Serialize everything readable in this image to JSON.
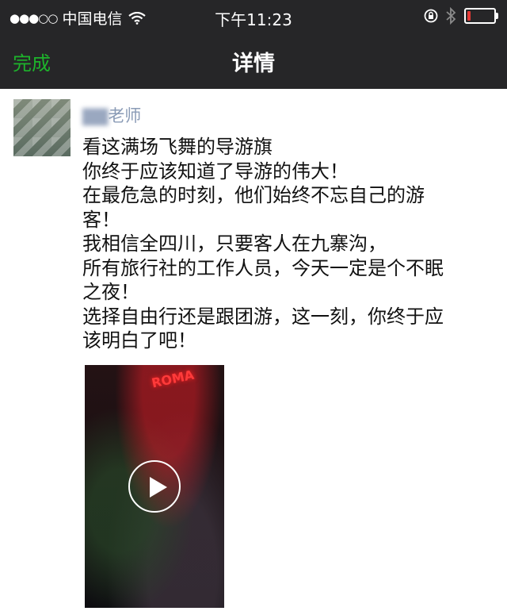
{
  "status_bar": {
    "signal": "●●●○○",
    "carrier": "中国电信",
    "time": "下午11:23",
    "battery_level": 0.12,
    "battery_color": "#e53935"
  },
  "nav_bar": {
    "done_label": "完成",
    "title": "详情",
    "accent_color": "#1db32b"
  },
  "post": {
    "author_masked": "▇▇",
    "author_suffix": "老师",
    "lines": [
      "看这满场飞舞的导游旗",
      "你终于应该知道了导游的伟大！",
      "在最危急的时刻，他们始终不忘自己的游",
      "客！",
      "我相信全四川，只要客人在九寨沟，",
      "所有旅行社的工作人员，今天一定是个不眠",
      "之夜！",
      "选择自由行还是跟团游，这一刻，你终于应",
      "该明白了吧！"
    ],
    "video_sign": "ROMA"
  },
  "icons": [
    "wifi-icon",
    "lock-rotation-icon",
    "bluetooth-icon",
    "battery-icon",
    "play-icon"
  ]
}
